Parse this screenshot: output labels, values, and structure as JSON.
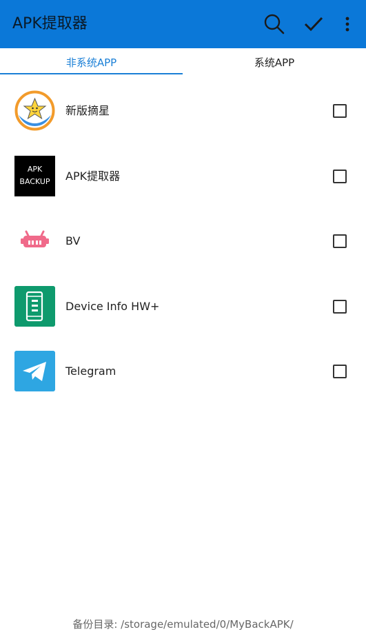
{
  "toolbar": {
    "title": "APK提取器",
    "search_icon": "search-icon",
    "confirm_icon": "check-icon",
    "more_icon": "more-vert-icon"
  },
  "tabs": [
    {
      "label": "非系统APP",
      "selected": true
    },
    {
      "label": "系统APP",
      "selected": false
    }
  ],
  "apps": [
    {
      "name": "新版摘星",
      "icon": "zhaixing-star-icon",
      "checked": false
    },
    {
      "name": "APK提取器",
      "icon": "apk-backup-icon",
      "icon_text": [
        "APK",
        "BACKUP"
      ],
      "checked": false
    },
    {
      "name": "BV",
      "icon": "bv-robot-icon",
      "checked": false
    },
    {
      "name": "Device Info HW+",
      "icon": "device-info-icon",
      "checked": false
    },
    {
      "name": "Telegram",
      "icon": "telegram-icon",
      "checked": false
    }
  ],
  "footer": {
    "backup_dir": "备份目录: /storage/emulated/0/MyBackAPK/"
  },
  "colors": {
    "toolbar_bg": "#0b78d8",
    "accent": "#1a7fd6"
  }
}
